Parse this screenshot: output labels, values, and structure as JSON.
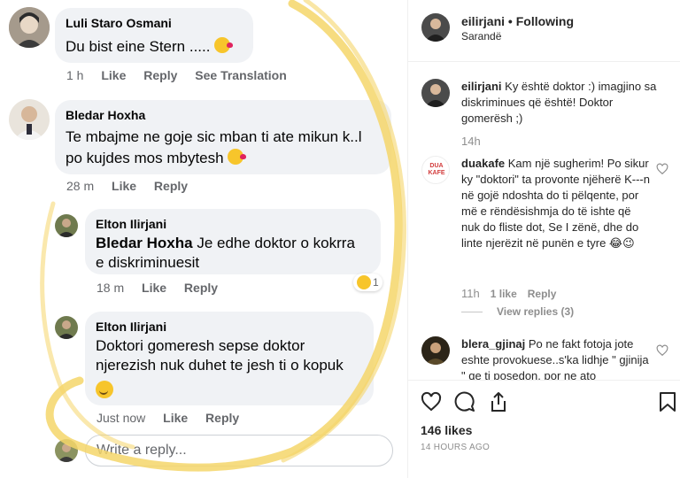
{
  "facebook": {
    "comments": [
      {
        "author": "Luli Staro Osmani",
        "text": "Du bist eine Stern .....",
        "time": "1 h",
        "like": "Like",
        "reply": "Reply",
        "translate": "See Translation"
      },
      {
        "author": "Bledar Hoxha",
        "text_line1": "Te mbajme ne goje sic mban ti ate mikun k..l",
        "text_line2": "po kujdes mos mbytesh",
        "time": "28 m",
        "like": "Like",
        "reply": "Reply"
      },
      {
        "author": "Elton Ilirjani",
        "mention": "Bledar Hoxha",
        "text_line1": " Je edhe doktor o kokrra",
        "text_line2": "e diskriminuesit",
        "time": "18 m",
        "like": "Like",
        "reply": "Reply",
        "reaction_count": "1"
      },
      {
        "author": "Elton Ilirjani",
        "text_line1": "Doktori gomeresh sepse doktor",
        "text_line2": "njerezish nuk duhet te jesh ti o kopuk",
        "time": "Just now",
        "like": "Like",
        "reply": "Reply"
      }
    ],
    "write_reply_placeholder": "Write a reply..."
  },
  "instagram": {
    "header": {
      "username": "eilirjani",
      "separator": " • ",
      "follow_status": "Following",
      "location": "Sarandë"
    },
    "caption": {
      "username": "eilirjani",
      "text": " Ky është doktor :) imagjino sa diskriminues që është! Doktor gomerësh ;)",
      "time": "14h"
    },
    "comments": [
      {
        "username": "duakafe",
        "avatar_line1": "DUA",
        "avatar_line2": "KAFE",
        "text": " Kam një sugherim! Po sikur ky \"doktori\" ta provonte njëherë K---n në gojë ndoshta do ti pëlqente, por më e rëndësishmja do të ishte që nuk do fliste dot, Se I zënë, dhe do linte njerëzit në punën e tyre 😂😉",
        "time": "11h",
        "likes": "1 like",
        "reply": "Reply",
        "view_replies": "View replies (3)"
      },
      {
        "username": "blera_gjinaj",
        "text": " Po ne fakt fotoja jote eshte provokuese..s'ka lidhje \" gjinija \" qe ti posedon, por ne ato"
      }
    ],
    "likes": "146 likes",
    "timestamp": "14 HOURS AGO"
  },
  "colors": {
    "scribble": "#f5d66a",
    "fb_bubble": "#f0f2f5",
    "ig_text": "#262626",
    "ig_muted": "#8e8e8e"
  }
}
